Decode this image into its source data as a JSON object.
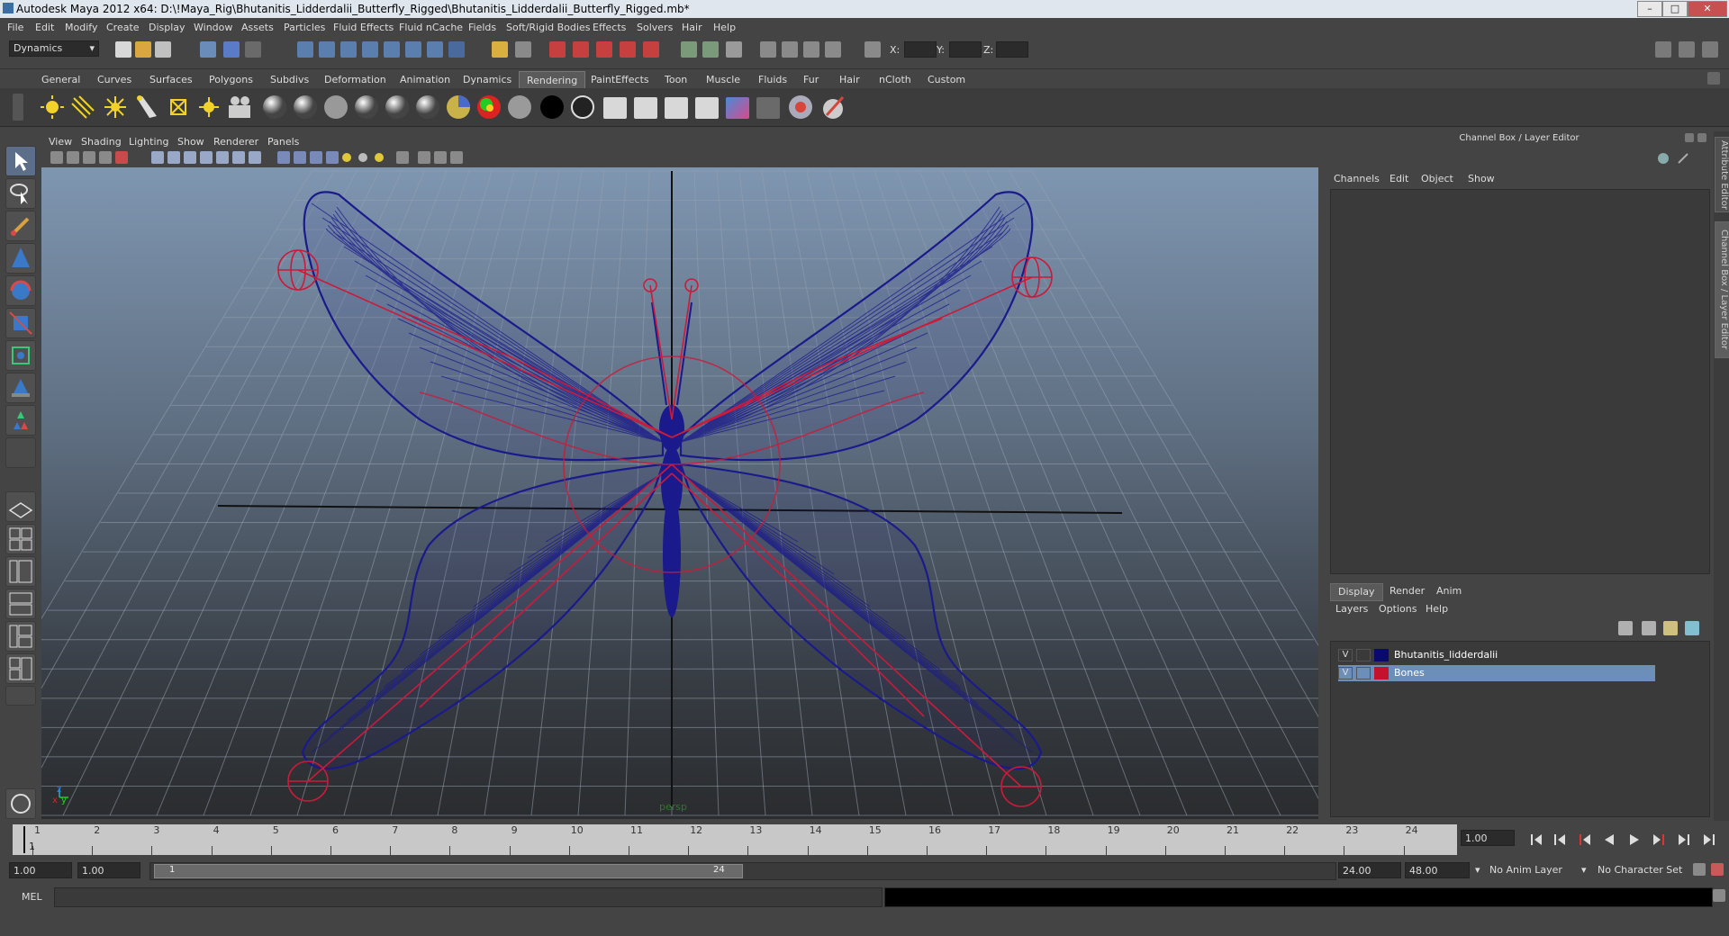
{
  "window": {
    "title": "Autodesk Maya 2012 x64: D:\\!Maya_Rig\\Bhutanitis_Lidderdalii_Butterfly_Rigged\\Bhutanitis_Lidderdalii_Butterfly_Rigged.mb*",
    "min_symbol": "–",
    "max_symbol": "□",
    "close_symbol": "✕"
  },
  "menubar": [
    "File",
    "Edit",
    "Modify",
    "Create",
    "Display",
    "Window",
    "Assets",
    "Particles",
    "Fluid Effects",
    "Fluid nCache",
    "Fields",
    "Soft/Rigid Bodies",
    "Effects",
    "Solvers",
    "Hair",
    "Help"
  ],
  "status": {
    "menuset": "Dynamics",
    "x_label": "X:",
    "y_label": "Y:",
    "z_label": "Z:"
  },
  "shelf_tabs": [
    "General",
    "Curves",
    "Surfaces",
    "Polygons",
    "Subdivs",
    "Deformation",
    "Animation",
    "Dynamics",
    "Rendering",
    "PaintEffects",
    "Toon",
    "Muscle",
    "Fluids",
    "Fur",
    "Hair",
    "nCloth",
    "Custom"
  ],
  "shelf_active": "Rendering",
  "viewport": {
    "menus": [
      "View",
      "Shading",
      "Lighting",
      "Show",
      "Renderer",
      "Panels"
    ],
    "camera_label": "persp",
    "axis_x": "x",
    "axis_y": "y",
    "axis_z": "z",
    "wire_color": "#1a1a8c",
    "bone_color": "#cc1a3a"
  },
  "channel_box": {
    "title": "Channel Box / Layer Editor",
    "menus": [
      "Channels",
      "Edit",
      "Object",
      "Show"
    ]
  },
  "layer_editor": {
    "tabs": [
      "Display",
      "Render",
      "Anim"
    ],
    "active_tab": "Display",
    "menus": [
      "Layers",
      "Options",
      "Help"
    ],
    "layers": [
      {
        "visible": "V",
        "name": "Bhutanitis_lidderdalii",
        "color": "#0a0a6e",
        "selected": false
      },
      {
        "visible": "V",
        "name": "Bones",
        "color": "#c4122e",
        "selected": true
      }
    ]
  },
  "side_tabs": [
    "Attribute Editor",
    "Channel Box / Layer Editor"
  ],
  "timeline": {
    "ticks": [
      "1",
      "2",
      "3",
      "4",
      "5",
      "6",
      "7",
      "8",
      "9",
      "10",
      "11",
      "12",
      "13",
      "14",
      "15",
      "16",
      "17",
      "18",
      "19",
      "20",
      "21",
      "22",
      "23",
      "24"
    ],
    "current_frame": "1",
    "current_time_field": "1.00"
  },
  "range": {
    "start_time": "1.00",
    "playback_start": "1.00",
    "slider_start": "1",
    "slider_end": "24",
    "playback_end": "24.00",
    "end_time": "48.00",
    "anim_layer": "No Anim Layer",
    "character_set": "No Character Set"
  },
  "command_line": {
    "label": "MEL"
  }
}
